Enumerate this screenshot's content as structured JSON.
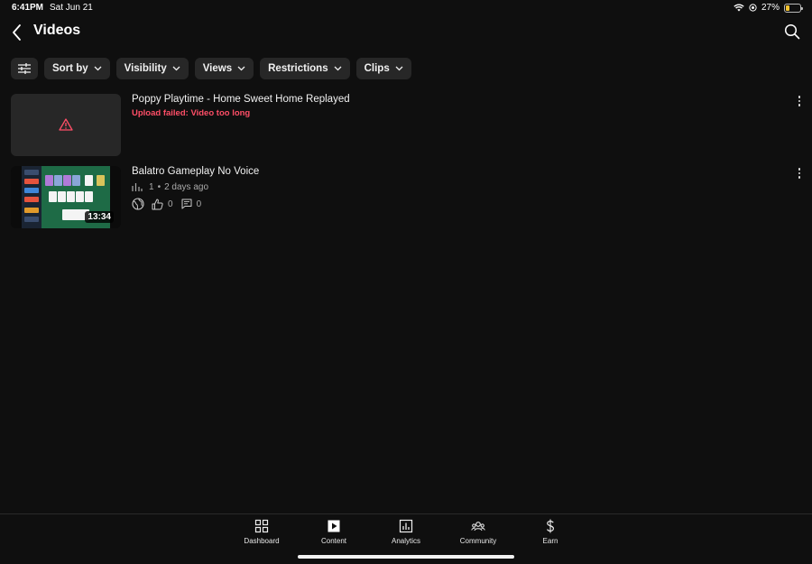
{
  "status_bar": {
    "time": "6:41PM",
    "date": "Sat Jun 21",
    "battery": "27%",
    "battery_level": 0.27
  },
  "header": {
    "title": "Videos"
  },
  "filters": [
    {
      "label": "Sort by"
    },
    {
      "label": "Visibility"
    },
    {
      "label": "Views"
    },
    {
      "label": "Restrictions"
    },
    {
      "label": "Clips"
    }
  ],
  "videos": [
    {
      "title": "Poppy Playtime - Home Sweet Home Replayed",
      "error": "Upload failed: Video too long"
    },
    {
      "title": "Balatro Gameplay No Voice",
      "views": "1",
      "separator": "•",
      "age": "2 days ago",
      "likes": "0",
      "comments": "0",
      "duration": "13:34"
    }
  ],
  "nav": [
    {
      "label": "Dashboard",
      "icon": "dashboard-icon"
    },
    {
      "label": "Content",
      "icon": "content-icon"
    },
    {
      "label": "Analytics",
      "icon": "analytics-icon"
    },
    {
      "label": "Community",
      "icon": "community-icon"
    },
    {
      "label": "Earn",
      "icon": "dollar-icon"
    }
  ],
  "colors": {
    "background": "#0f0f0f",
    "chip": "#272727",
    "error": "#ff4e67"
  }
}
